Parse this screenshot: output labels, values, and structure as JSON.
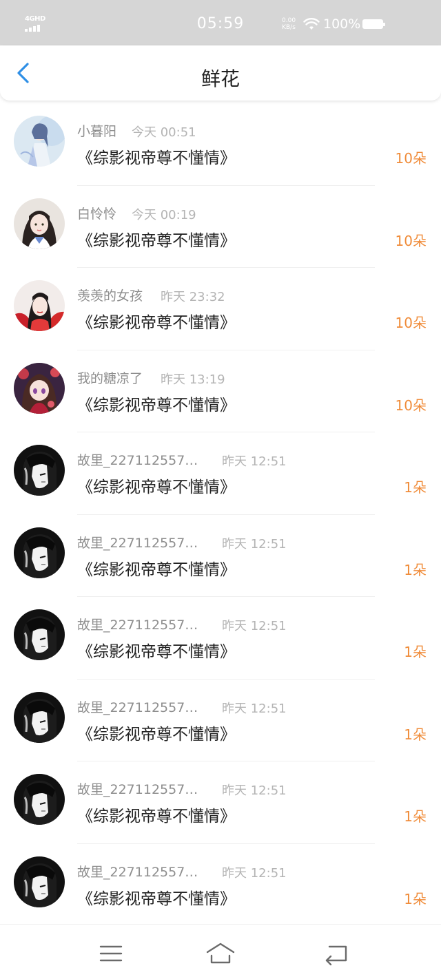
{
  "status_bar": {
    "network": "4GHD",
    "time": "05:59",
    "speed_value": "0.00",
    "speed_unit": "KB/s",
    "battery": "100%"
  },
  "nav": {
    "title": "鲜花",
    "back_icon": "chevron-left-icon"
  },
  "records": [
    {
      "name": "小暮阳",
      "time": "今天 00:51",
      "book": "《综影视帝尊不懂情》",
      "count": "10朵",
      "avatar": "anime-boy-avatar"
    },
    {
      "name": "白怜怜",
      "time": "今天 00:19",
      "book": "《综影视帝尊不懂情》",
      "count": "10朵",
      "avatar": "girl-photo-avatar"
    },
    {
      "name": "羡羡的女孩",
      "time": "昨天 23:32",
      "book": "《综影视帝尊不懂情》",
      "count": "10朵",
      "avatar": "costume-girl-avatar"
    },
    {
      "name": "我的糖凉了",
      "time": "昨天 13:19",
      "book": "《综影视帝尊不懂情》",
      "count": "10朵",
      "avatar": "anime-girl-avatar"
    },
    {
      "name": "故里_227112557…",
      "time": "昨天 12:51",
      "book": "《综影视帝尊不懂情》",
      "count": "1朵",
      "avatar": "monochrome-anime-avatar"
    },
    {
      "name": "故里_227112557…",
      "time": "昨天 12:51",
      "book": "《综影视帝尊不懂情》",
      "count": "1朵",
      "avatar": "monochrome-anime-avatar"
    },
    {
      "name": "故里_227112557…",
      "time": "昨天 12:51",
      "book": "《综影视帝尊不懂情》",
      "count": "1朵",
      "avatar": "monochrome-anime-avatar"
    },
    {
      "name": "故里_227112557…",
      "time": "昨天 12:51",
      "book": "《综影视帝尊不懂情》",
      "count": "1朵",
      "avatar": "monochrome-anime-avatar"
    },
    {
      "name": "故里_227112557…",
      "time": "昨天 12:51",
      "book": "《综影视帝尊不懂情》",
      "count": "1朵",
      "avatar": "monochrome-anime-avatar"
    },
    {
      "name": "故里_227112557…",
      "time": "昨天 12:51",
      "book": "《综影视帝尊不懂情》",
      "count": "1朵",
      "avatar": "monochrome-anime-avatar"
    }
  ],
  "system_nav": {
    "menu_icon": "menu-icon",
    "home_icon": "home-icon",
    "back_icon": "back-icon"
  },
  "colors": {
    "accent_blue": "#2f8fe6",
    "count_orange": "#f08c3a",
    "status_bar_bg": "#d6d6d6"
  }
}
